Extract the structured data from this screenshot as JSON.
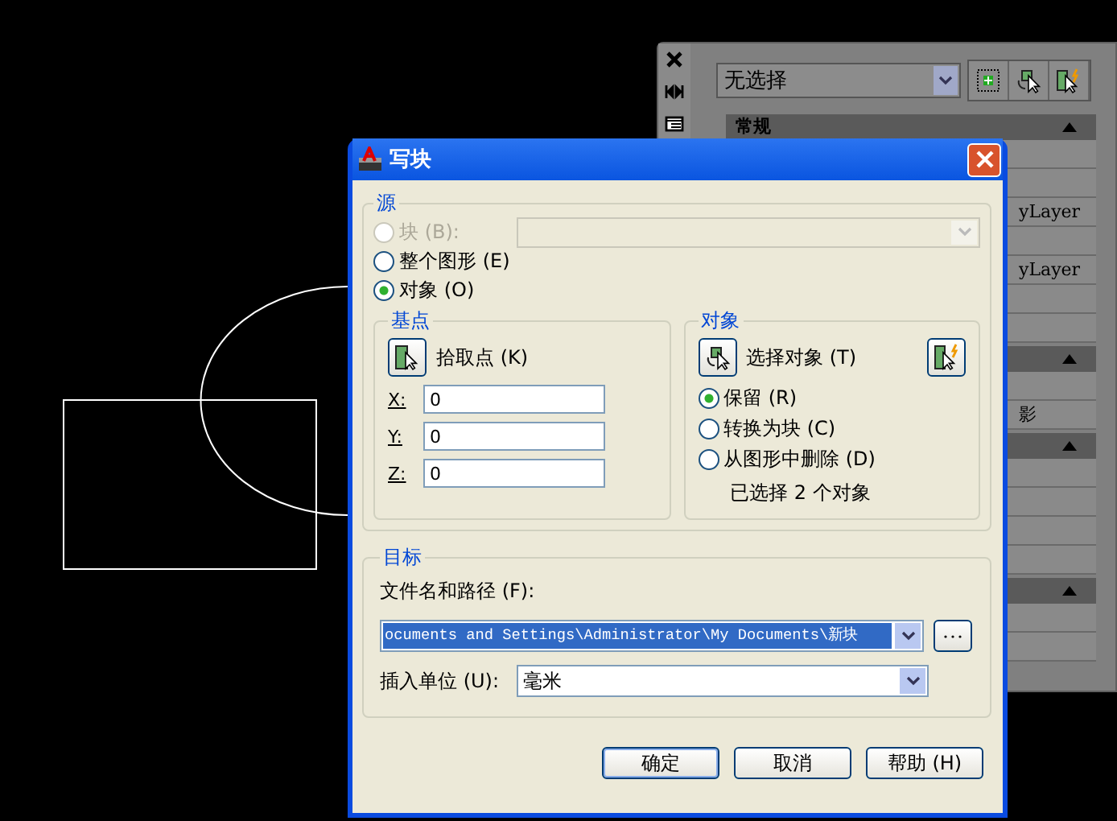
{
  "properties_palette": {
    "selection": "无选择",
    "sections": [
      {
        "title": "常规",
        "expanded": true,
        "rows": [
          null,
          null,
          "yLayer",
          null,
          "yLayer",
          null,
          null
        ]
      },
      {
        "expanded": true,
        "rows": [
          null,
          "影"
        ]
      },
      {
        "expanded": true,
        "rows": [
          null,
          null,
          null,
          null
        ]
      },
      {
        "expanded": true,
        "rows": [
          null,
          null
        ]
      }
    ]
  },
  "dialog": {
    "title": "写块",
    "source": {
      "title": "源",
      "options": [
        {
          "label": "块 (B):",
          "selected": false,
          "disabled": true
        },
        {
          "label": "整个图形 (E)",
          "selected": false,
          "disabled": false
        },
        {
          "label": "对象 (O)",
          "selected": true,
          "disabled": false
        }
      ]
    },
    "base_point": {
      "title": "基点",
      "pick_label": "拾取点 (K)",
      "fields": [
        {
          "label": "X:",
          "value": "0"
        },
        {
          "label": "Y:",
          "value": "0"
        },
        {
          "label": "Z:",
          "value": "0"
        }
      ]
    },
    "objects": {
      "title": "对象",
      "select_label": "选择对象 (T)",
      "options": [
        {
          "label": "保留 (R)",
          "selected": true
        },
        {
          "label": "转换为块 (C)",
          "selected": false
        },
        {
          "label": "从图形中删除 (D)",
          "selected": false
        }
      ],
      "status": "已选择 2 个对象"
    },
    "destination": {
      "title": "目标",
      "file_label": "文件名和路径 (F):",
      "file_path": "ocuments and Settings\\Administrator\\My Documents\\新块",
      "path_selected": true,
      "units_label": "插入单位 (U):",
      "units": "毫米"
    },
    "buttons": [
      "确定",
      "取消",
      "帮助 (H)"
    ]
  }
}
